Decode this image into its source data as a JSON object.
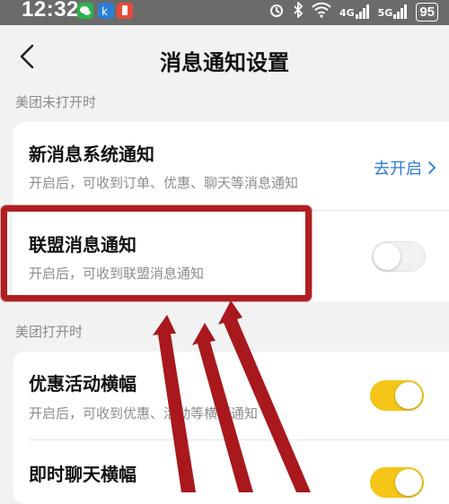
{
  "status_bar": {
    "time": "12:32",
    "battery": "95",
    "network_1": "4G",
    "network_2": "5G",
    "icons": [
      "wechat-icon",
      "app-icon",
      "notification-icon",
      "alarm-icon",
      "bluetooth-icon",
      "wifi-icon",
      "signal-icon",
      "signal-icon",
      "battery-icon"
    ]
  },
  "header": {
    "title": "消息通知设置",
    "back_icon": "chevron-left-icon"
  },
  "sections": [
    {
      "label": "美团未打开时",
      "items": [
        {
          "title": "新消息系统通知",
          "desc": "开启后，可收到订单、优惠、聊天等消息通知",
          "action": "去开启"
        },
        {
          "title": "联盟消息通知",
          "desc": "开启后，可收到联盟消息通知",
          "toggle_on": false
        }
      ]
    },
    {
      "label": "美团打开时",
      "items": [
        {
          "title": "优惠活动横幅",
          "desc": "开启后，可收到优惠、活动等横幅通知",
          "toggle_on": true
        },
        {
          "title": "即时聊天横幅",
          "toggle_on": true
        }
      ]
    }
  ],
  "colors": {
    "accent_link": "#2f7ad6",
    "toggle_on": "#f5c518",
    "annotation": "#b01e22",
    "status_bar": "#6b6b6b"
  }
}
